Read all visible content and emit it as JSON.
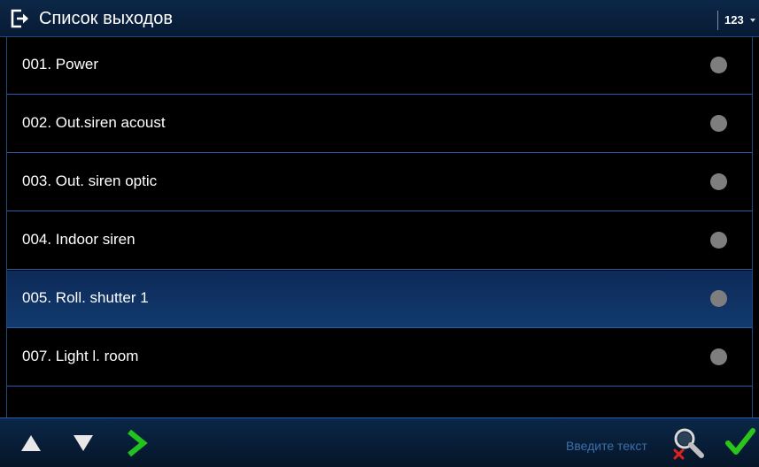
{
  "header": {
    "title": "Список выходов",
    "title_icon": "exit-icon",
    "keyboard_mode": "123"
  },
  "outputs": [
    {
      "label": "001. Power",
      "state_icon": "status-dot-icon",
      "state_color": "#7e7e7e"
    },
    {
      "label": "002. Out.siren acoust",
      "state_icon": "status-dot-icon",
      "state_color": "#7e7e7e"
    },
    {
      "label": "003. Out. siren optic",
      "state_icon": "status-dot-icon",
      "state_color": "#7e7e7e"
    },
    {
      "label": "004. Indoor siren",
      "state_icon": "status-dot-icon",
      "state_color": "#7e7e7e"
    },
    {
      "label": "005. Roll. shutter 1",
      "state_icon": "status-dot-icon",
      "state_color": "#7e7e7e",
      "selected": true
    },
    {
      "label": "007. Light l. room",
      "state_icon": "status-dot-icon",
      "state_color": "#7e7e7e"
    }
  ],
  "footer": {
    "up_icon": "arrow-up-icon",
    "down_icon": "arrow-down-icon",
    "enter_icon": "chevron-right-icon",
    "search_placeholder": "Введите текст",
    "search_icon": "magnifier-cancel-icon",
    "confirm_icon": "checkmark-icon"
  },
  "colors": {
    "header_bg": "#0c2748",
    "selected_row_bg": "#123a6e",
    "row_divider": "#2a5ea8",
    "status_dot": "#7e7e7e",
    "enter_green": "#22c31f",
    "confirm_green": "#2bc41b",
    "cancel_red": "#e0201b"
  }
}
